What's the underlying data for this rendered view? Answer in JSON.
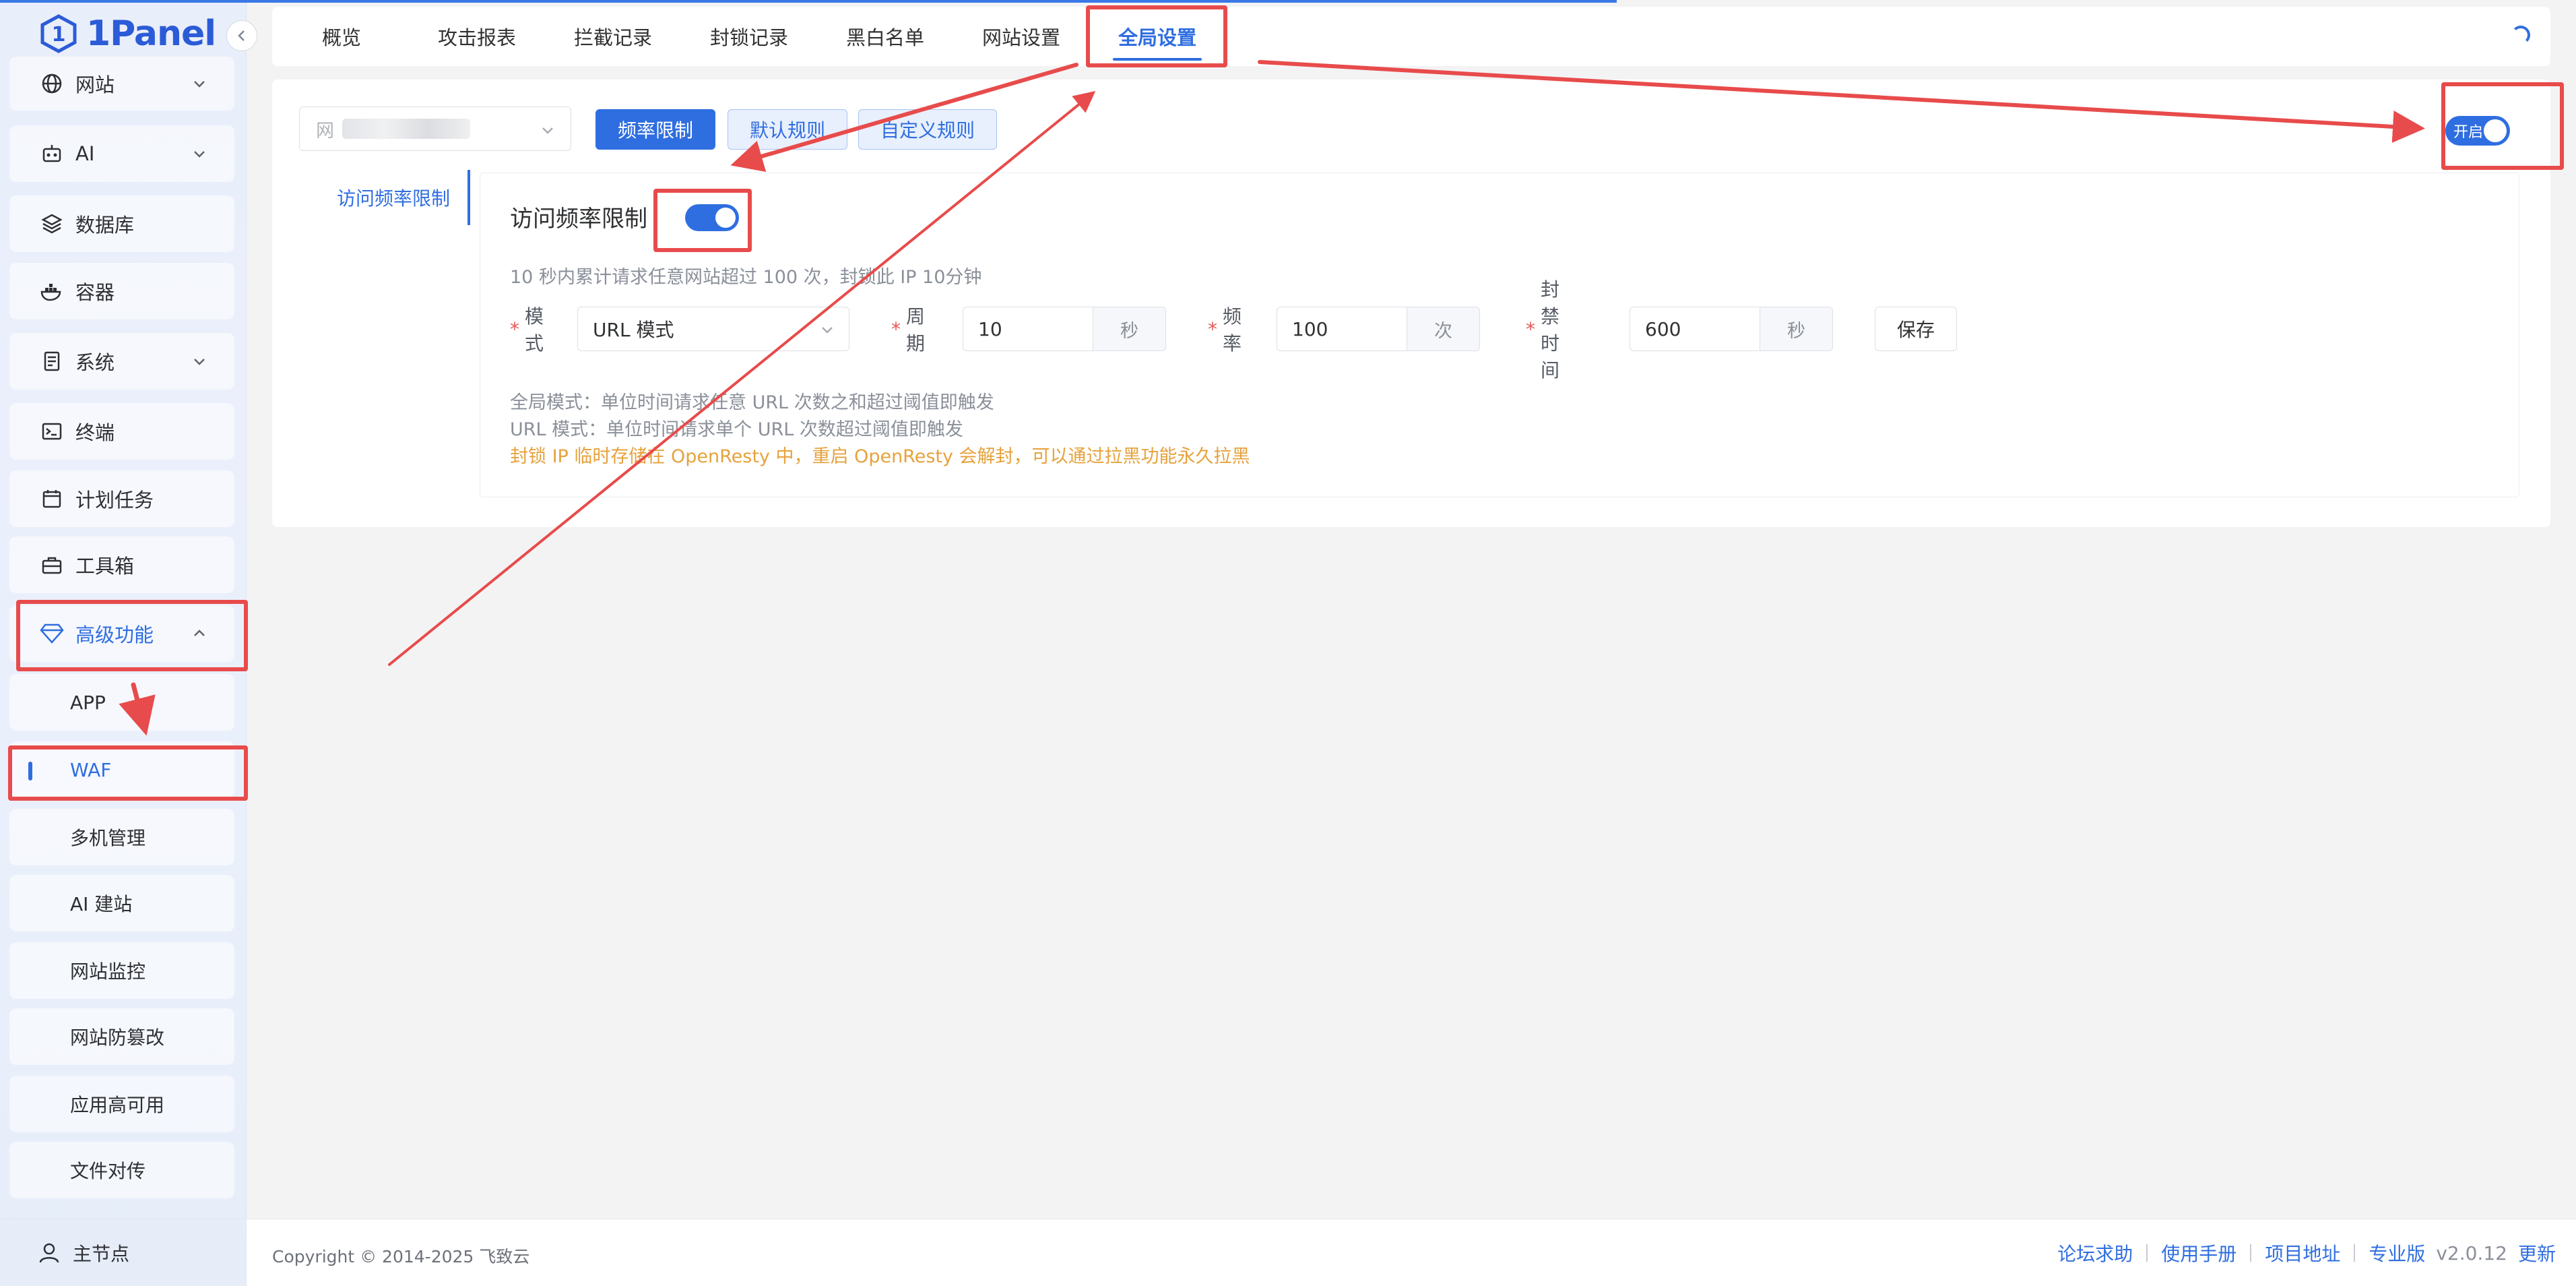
{
  "app": {
    "logo_text": "1Panel"
  },
  "sidebar": {
    "items": [
      {
        "label": "网站",
        "icon": "globe-icon"
      },
      {
        "label": "AI",
        "icon": "robot-icon"
      },
      {
        "label": "数据库",
        "icon": "layers-icon"
      },
      {
        "label": "容器",
        "icon": "docker-icon"
      },
      {
        "label": "系统",
        "icon": "server-icon"
      },
      {
        "label": "终端",
        "icon": "terminal-icon"
      },
      {
        "label": "计划任务",
        "icon": "calendar-icon"
      },
      {
        "label": "工具箱",
        "icon": "toolbox-icon"
      },
      {
        "label": "高级功能",
        "icon": "diamond-icon"
      }
    ],
    "sub_items": [
      "APP",
      "WAF",
      "多机管理",
      "AI 建站",
      "网站监控",
      "网站防篡改",
      "应用高可用",
      "文件对传"
    ],
    "footer_node": "主节点"
  },
  "tabs": [
    "概览",
    "攻击报表",
    "拦截记录",
    "封锁记录",
    "黑白名单",
    "网站设置",
    "全局设置"
  ],
  "toolbar": {
    "site_select_placeholder": "网",
    "btn_rate_limit": "频率限制",
    "btn_default_rules": "默认规则",
    "btn_custom_rules": "自定义规则",
    "global_switch_label": "开启"
  },
  "panel": {
    "side_nav": "访问频率限制",
    "title": "访问频率限制",
    "description": "10 秒内累计请求任意网站超过 100 次，封锁此 IP 10分钟",
    "mode_label": "模式",
    "mode_value": "URL 模式",
    "period_label": "周期",
    "period_value": "10",
    "period_unit": "秒",
    "freq_label": "频率",
    "freq_value": "100",
    "freq_unit": "次",
    "ban_label": "封禁时间",
    "ban_value": "600",
    "ban_unit": "秒",
    "save": "保存",
    "note1": "全局模式：单位时间请求任意 URL 次数之和超过阈值即触发",
    "note2": "URL 模式：单位时间请求单个 URL 次数超过阈值即触发",
    "note3": "封锁 IP 临时存储在 OpenResty 中，重启 OpenResty 会解封，可以通过拉黑功能永久拉黑"
  },
  "footer": {
    "copyright": "Copyright © 2014-2025 飞致云",
    "links": [
      "论坛求助",
      "使用手册",
      "项目地址",
      "专业版"
    ],
    "version": "v2.0.12",
    "update": "更新"
  },
  "colors": {
    "accent": "#2f6ee0",
    "annotation": "#e84b4b",
    "warning": "#e6a23c"
  }
}
